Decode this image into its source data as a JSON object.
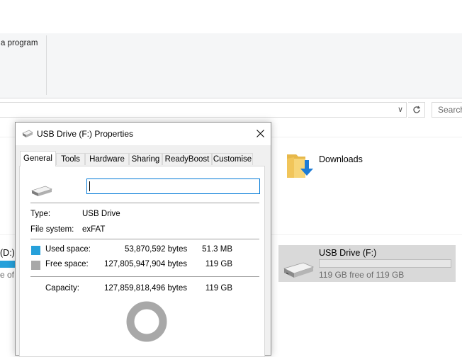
{
  "ribbon": {
    "run_program_label": "a program"
  },
  "address": {
    "chevron": "∨",
    "search_placeholder": "Search"
  },
  "content": {
    "folders": [
      {
        "name": "Downloads",
        "icon": "downloads-folder-icon"
      }
    ],
    "drives": [
      {
        "label": "(D:)",
        "free": "e of",
        "used_fraction": 1.0
      },
      {
        "label": "USB Drive (F:)",
        "free": "119 GB free of 119 GB",
        "used_fraction": 0.0004,
        "icon": "usb-drive-icon"
      }
    ]
  },
  "dialog": {
    "title": "USB Drive (F:) Properties",
    "tabs": [
      "General",
      "Tools",
      "Hardware",
      "Sharing",
      "ReadyBoost",
      "Customise"
    ],
    "active_tab": "General",
    "name_value": "",
    "type_label": "Type:",
    "type_value": "USB Drive",
    "fs_label": "File system:",
    "fs_value": "exFAT",
    "used": {
      "label": "Used space:",
      "bytes": "53,870,592 bytes",
      "size": "51.3 MB",
      "color": "#26a0da"
    },
    "free": {
      "label": "Free space:",
      "bytes": "127,805,947,904 bytes",
      "size": "119 GB",
      "color": "#a8a8a8"
    },
    "capacity": {
      "label": "Capacity:",
      "bytes": "127,859,818,496 bytes",
      "size": "119 GB"
    }
  },
  "colors": {
    "accent": "#26a0da",
    "free_gray": "#a8a8a8",
    "selection": "#d9d9d9"
  }
}
